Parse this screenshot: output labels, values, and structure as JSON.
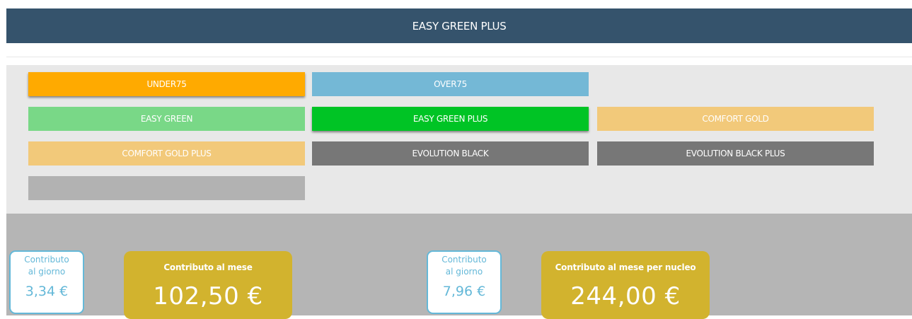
{
  "header": {
    "title": "EASY GREEN PLUS"
  },
  "plans": [
    {
      "label": "UNDER75",
      "color": "#ffaa00",
      "active": true
    },
    {
      "label": "OVER75",
      "color": "#74b8d6",
      "active": false
    },
    {
      "label": "EASY GREEN",
      "color": "#79d887",
      "active": false
    },
    {
      "label": "EASY GREEN PLUS",
      "color": "#00c425",
      "active": true
    },
    {
      "label": "COMFORT GOLD",
      "color": "#f2c97a",
      "active": false
    },
    {
      "label": "COMFORT GOLD PLUS",
      "color": "#f2c97a",
      "active": false
    },
    {
      "label": "EVOLUTION BLACK",
      "color": "#777777",
      "active": false
    },
    {
      "label": "EVOLUTION BLACK PLUS",
      "color": "#777777",
      "active": false
    },
    {
      "label": "",
      "color": "#b2b2b2",
      "active": false
    }
  ],
  "summary": {
    "individual": {
      "daily_label_line1": "Contributo",
      "daily_label_line2": "al giorno",
      "daily_value": "3,34 €",
      "monthly_label": "Contributo al mese",
      "monthly_value": "102,50 €"
    },
    "family": {
      "daily_label_line1": "Contributo",
      "daily_label_line2": "al giorno",
      "daily_value": "7,96 €",
      "monthly_label": "Contributo al mese per nucleo",
      "monthly_value": "244,00 €"
    }
  },
  "colors": {
    "header_bg": "#35536c",
    "card_gold": "#d2b32e",
    "card_border_blue": "#64b8d8"
  }
}
